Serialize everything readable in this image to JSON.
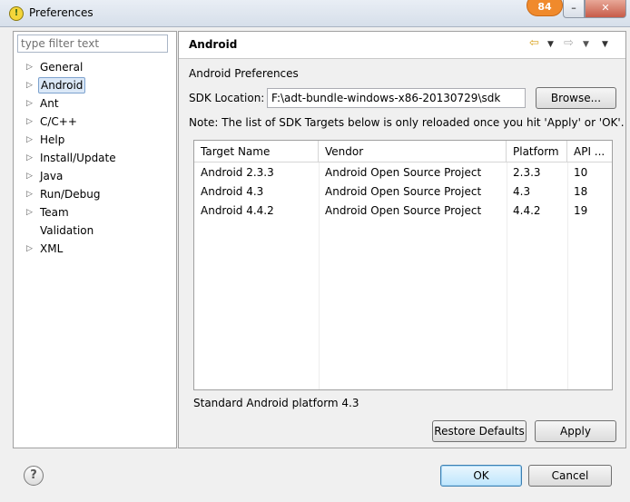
{
  "window": {
    "title": "Preferences",
    "badge": "84",
    "minimize_glyph": "–",
    "close_glyph": "✕"
  },
  "sidebar": {
    "filter_placeholder": "type filter text",
    "items": [
      {
        "label": "General",
        "expandable": true
      },
      {
        "label": "Android",
        "expandable": true,
        "selected": true
      },
      {
        "label": "Ant",
        "expandable": true
      },
      {
        "label": "C/C++",
        "expandable": true
      },
      {
        "label": "Help",
        "expandable": true
      },
      {
        "label": "Install/Update",
        "expandable": true
      },
      {
        "label": "Java",
        "expandable": true
      },
      {
        "label": "Run/Debug",
        "expandable": true
      },
      {
        "label": "Team",
        "expandable": true
      },
      {
        "label": "Validation",
        "expandable": false
      },
      {
        "label": "XML",
        "expandable": true
      }
    ]
  },
  "page": {
    "title": "Android",
    "section_label": "Android Preferences",
    "sdk_label": "SDK Location:",
    "sdk_value": "F:\\adt-bundle-windows-x86-20130729\\sdk",
    "browse_label": "Browse...",
    "note": "Note: The list of SDK Targets below is only reloaded once you hit 'Apply' or 'OK'.",
    "table": {
      "columns": [
        "Target Name",
        "Vendor",
        "Platform",
        "API ..."
      ],
      "rows": [
        [
          "Android 2.3.3",
          "Android Open Source Project",
          "2.3.3",
          "10"
        ],
        [
          "Android 4.3",
          "Android Open Source Project",
          "4.3",
          "18"
        ],
        [
          "Android 4.4.2",
          "Android Open Source Project",
          "4.4.2",
          "19"
        ]
      ]
    },
    "description": "Standard Android platform 4.3",
    "restore_label": "Restore Defaults",
    "apply_label": "Apply"
  },
  "footer": {
    "help_glyph": "?",
    "ok_label": "OK",
    "cancel_label": "Cancel"
  },
  "colors": {
    "selection_bg": "#dbe8f7",
    "badge": "#f08a2c"
  }
}
